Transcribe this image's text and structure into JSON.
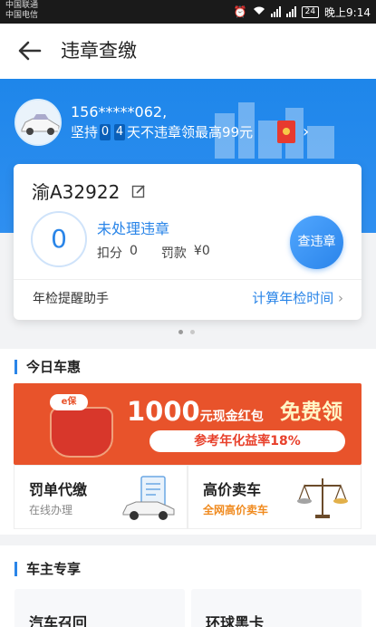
{
  "status_bar": {
    "carrier_1": "中国联通",
    "carrier_2": "中国电信",
    "battery": "24",
    "time": "晚上9:14"
  },
  "header": {
    "title": "违章查缴",
    "back_icon": "arrow-left-icon"
  },
  "banner": {
    "phone": "156*****062,",
    "promo_prefix": "坚持",
    "digit_1": "0",
    "digit_2": "4",
    "promo_suffix": "天不违章领最高99元"
  },
  "card": {
    "plate": "渝A32922",
    "violation_count": "0",
    "unhandled_label": "未处理违章",
    "points_label": "扣分",
    "points_value": "0",
    "fine_label": "罚款",
    "fine_value": "¥0",
    "query_button": "查违章",
    "inspection_label": "年检提醒助手",
    "calc_link": "计算年检时间"
  },
  "today": {
    "title": "今日车惠",
    "promo_logo": "e保",
    "promo_amount": "1000",
    "promo_amount_unit": "元现金红包",
    "promo_free": "免费领",
    "promo_sub": "参考年化益率18%",
    "tile_fine_title": "罚单代缴",
    "tile_fine_sub": "在线办理",
    "tile_sell_title": "高价卖车",
    "tile_sell_sub": "全网高价卖车"
  },
  "owner": {
    "title": "车主专享",
    "tile_recall": "汽车召回",
    "tile_card": "环球黑卡"
  },
  "colors": {
    "accent_blue": "#2a85e8",
    "banner_blue": "#1e86ea",
    "promo_orange": "#e8532b"
  }
}
